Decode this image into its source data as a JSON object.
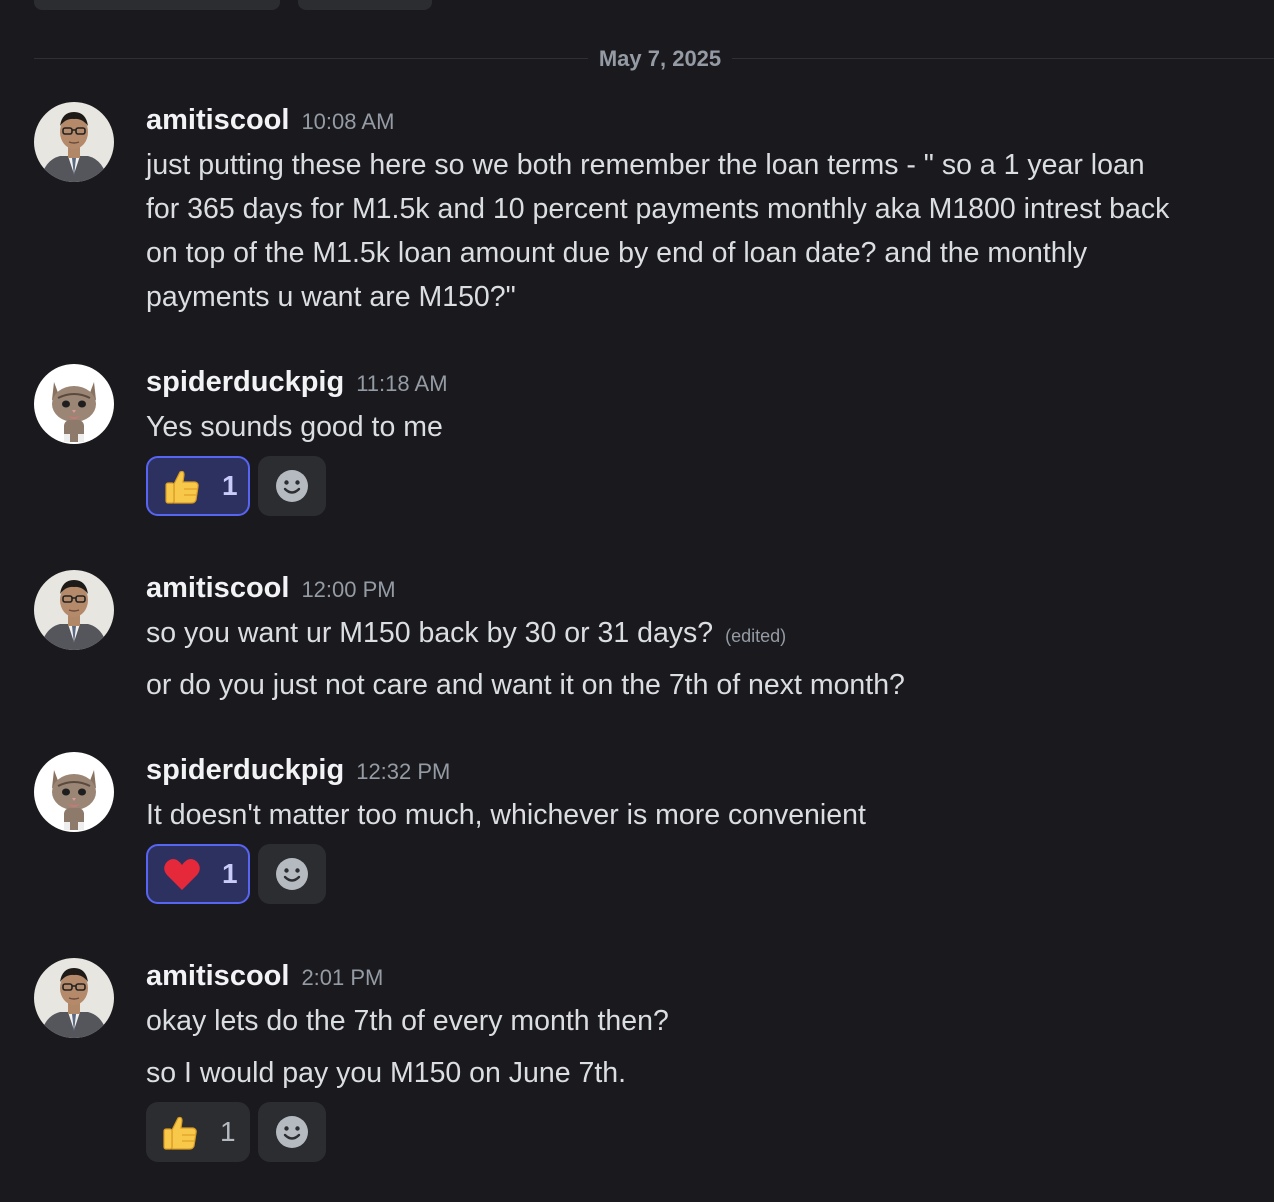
{
  "date_divider": "May 7, 2025",
  "messages": [
    {
      "author": "amitiscool",
      "time": "10:08 AM",
      "lines": [
        "just putting these here so we both remember the loan terms  - \" so a 1 year loan",
        "for 365 days for M1.5k and 10 percent payments monthly aka M1800 intrest back",
        "on top of the M1.5k loan amount due by end of loan date?  and the monthly",
        "payments u want are M150?\""
      ]
    },
    {
      "author": "spiderduckpig",
      "time": "11:18 AM",
      "lines": [
        "Yes sounds good to me"
      ],
      "reaction": {
        "emoji": "thumbs-up-icon",
        "count": "1"
      }
    },
    {
      "author": "amitiscool",
      "time": "12:00 PM",
      "lines": [
        "so you want ur M150 back by 30 or 31 days?",
        "or do you just not care and want it on the 7th of next month?"
      ],
      "edited": "(edited)"
    },
    {
      "author": "spiderduckpig",
      "time": "12:32 PM",
      "lines": [
        "It doesn't matter too much, whichever is more convenient"
      ],
      "reaction": {
        "emoji": "heart-icon",
        "count": "1"
      }
    },
    {
      "author": "amitiscool",
      "time": "2:01 PM",
      "lines": [
        "okay lets do the 7th of every month then?",
        "so I would pay you M150 on June 7th."
      ],
      "reaction": {
        "emoji": "thumbs-up-icon",
        "count": "1"
      }
    }
  ],
  "colors": {
    "background": "#1a1a1e",
    "accent": "#5865f2",
    "reaction_active_bg": "#2d3160"
  }
}
